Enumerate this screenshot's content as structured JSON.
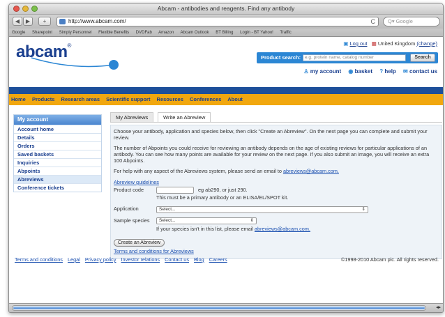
{
  "window": {
    "title": "Abcam - antibodies and reagents. Find any antibody"
  },
  "toolbar": {
    "back": "◀",
    "forward": "▶",
    "add": "+",
    "url": "http://www.abcam.com/",
    "reload": "C",
    "search_placeholder": "Q▾ Google"
  },
  "bookmarks": [
    "Google",
    "Sharepoint",
    "Simply Personnel",
    "Flexible Benefits",
    "DVDFab",
    "Amazon",
    "Abcam Outlook",
    "BT Billing",
    "Login - BT Yahoo!",
    "Traffic"
  ],
  "header": {
    "logo": "abcam",
    "logout": "Log out",
    "region": "United Kingdom",
    "change": "(change)",
    "search_label": "Product search:",
    "search_placeholder": "e.g. protein name, catalog number",
    "search_button": "Search",
    "my_account": "my account",
    "basket": "basket",
    "help": "help",
    "contact": "contact us"
  },
  "nav": [
    "Home",
    "Products",
    "Research areas",
    "Scientific support",
    "Resources",
    "Conferences",
    "About"
  ],
  "sidebar": {
    "title": "My account",
    "items": [
      "Account home",
      "Details",
      "Orders",
      "Saved baskets",
      "Inquiries",
      "Abpoints",
      "Abreviews",
      "Conference tickets"
    ]
  },
  "tabs": [
    "My Abreviews",
    "Write an Abreview"
  ],
  "content": {
    "p1": "Choose your antibody, application and species below, then click \"Create an Abreview\". On the next page you can complete and submit your review.",
    "p2": "The number of Abpoints you could receive for reviewing an antibody depends on the age of existing reviews for particular applications of an antibody. You can see how many points are available for your review on the next page. If you also submit an image, you will receive an extra 100 Abpoints.",
    "p3_text": "For help with any aspect of the Abreviews system, please send an email to",
    "p3_email": "abreviews@abcam.com.",
    "guidelines": "Abreview guidelines",
    "product_label": "Product code",
    "product_hint": "eg ab290, or just 290.",
    "product_note": "This must be a primary antibody or an ELISA/EL/SPOT kit.",
    "application_label": "Application",
    "application_value": "Select...",
    "species_label": "Sample species",
    "species_value": "Select...",
    "species_hint": "If your species isn't in this list, please email",
    "species_email": "abreviews@abcam.com.",
    "create_button": "Create an Abreview",
    "terms_link": "Terms and conditions for Abreviews"
  },
  "footer": {
    "links": [
      "Terms and conditions",
      "Legal",
      "Privacy policy",
      "Investor relations",
      "Contact us",
      "Blog",
      "Careers"
    ],
    "copyright": "©1998-2010 Abcam plc. All rights reserved."
  },
  "colors": {
    "brand_blue": "#1a3f8f",
    "nav_orange": "#f1a70f",
    "accent_blue": "#2b86d4"
  }
}
